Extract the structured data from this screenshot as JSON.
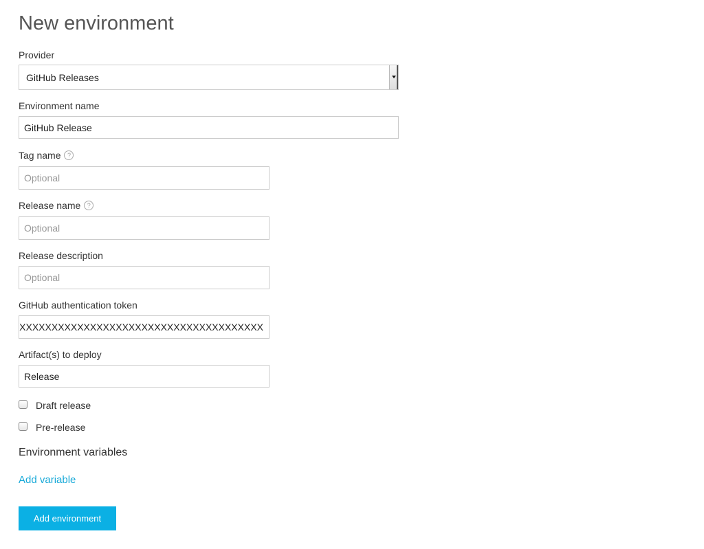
{
  "page": {
    "title": "New environment"
  },
  "form": {
    "provider": {
      "label": "Provider",
      "selected": "GitHub Releases"
    },
    "environment_name": {
      "label": "Environment name",
      "value": "GitHub Release"
    },
    "tag_name": {
      "label": "Tag name",
      "help": "?",
      "placeholder": "Optional"
    },
    "release_name": {
      "label": "Release name",
      "help": "?",
      "placeholder": "Optional"
    },
    "release_description": {
      "label": "Release description",
      "placeholder": "Optional"
    },
    "auth_token": {
      "label": "GitHub authentication token",
      "value": "XXXXXXXXXXXXXXXXXXXXXXXXXXXXXXXXXXXXXXXX"
    },
    "artifacts": {
      "label": "Artifact(s) to deploy",
      "value": "Release"
    },
    "draft_release": {
      "label": "Draft release",
      "checked": false
    },
    "pre_release": {
      "label": "Pre-release",
      "checked": false
    }
  },
  "env_vars": {
    "title": "Environment variables",
    "add_label": "Add variable"
  },
  "actions": {
    "submit_label": "Add environment"
  },
  "colors": {
    "accent": "#0bb0e4",
    "link": "#17a9d8"
  }
}
